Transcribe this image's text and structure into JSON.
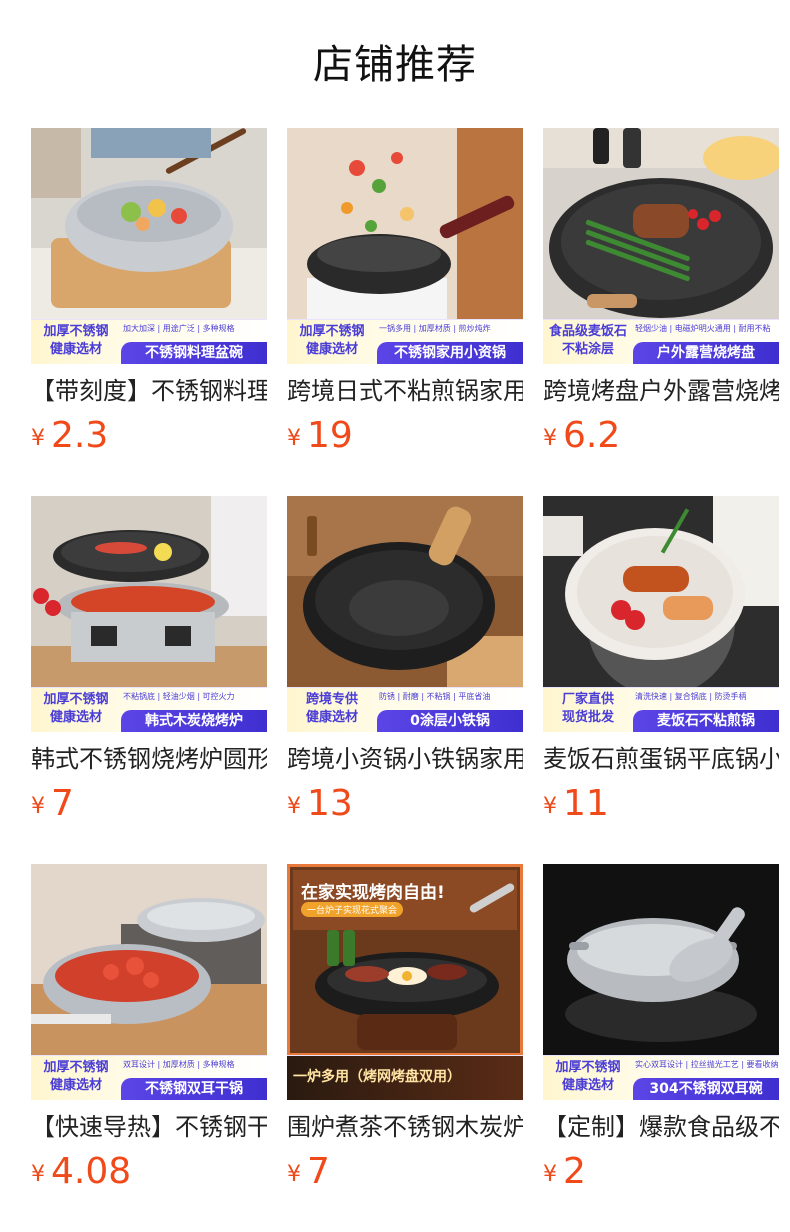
{
  "page": {
    "title": "店铺推荐"
  },
  "colors": {
    "price": "#f04a1a",
    "banner_purple": "#4a3dd6"
  },
  "products": [
    {
      "title": "【带刻度】不锈钢料理盆",
      "currency": "¥",
      "price": "2.3",
      "badge_line1": "加厚不锈钢",
      "badge_line2": "健康选材",
      "tags": "加大加深 | 用途广泛 | 多种规格",
      "pill": "不锈钢料理盆碗",
      "image": "stainless-bowl-salad"
    },
    {
      "title": "跨境日式不粘煎锅家用",
      "currency": "¥",
      "price": "19",
      "badge_line1": "加厚不锈钢",
      "badge_line2": "健康选材",
      "tags": "一锅多用 | 加厚材质 | 煎炒炖炸",
      "pill": "不锈钢家用小资锅",
      "image": "nonstick-wok-food-toss"
    },
    {
      "title": "跨境烤盘户外露营烧烤",
      "currency": "¥",
      "price": "6.2",
      "badge_line1": "食品级麦饭石",
      "badge_line2": "不粘涂层",
      "tags": "轻烟少油 | 电磁炉明火通用 | 耐用不粘",
      "pill": "户外露营烧烤盘",
      "image": "grill-pan-steak-asparagus"
    },
    {
      "title": "韩式不锈钢烧烤炉圆形",
      "currency": "¥",
      "price": "7",
      "badge_line1": "加厚不锈钢",
      "badge_line2": "健康选材",
      "tags": "不粘锅底 | 轻油少烟 | 可控火力",
      "pill": "韩式木炭烧烤炉",
      "image": "charcoal-bbq-stove"
    },
    {
      "title": "跨境小资锅小铁锅家用",
      "currency": "¥",
      "price": "13",
      "badge_line1": "跨境专供",
      "badge_line2": "健康选材",
      "tags": "防锈 | 耐磨 | 不粘锅 | 平底省油",
      "pill": "0涂层小铁锅",
      "image": "iron-wok-wood-handle"
    },
    {
      "title": "麦饭石煎蛋锅平底锅小",
      "currency": "¥",
      "price": "11",
      "badge_line1": "厂家直供",
      "badge_line2": "现货批发",
      "tags": "清洗快速 | 复合锅底 | 防烫手柄",
      "pill": "麦饭石不粘煎锅",
      "image": "white-frying-pan-sausage"
    },
    {
      "title": "【快速导热】不锈钢干锅",
      "currency": "¥",
      "price": "4.08",
      "badge_line1": "加厚不锈钢",
      "badge_line2": "健康选材",
      "tags": "双耳设计 | 加厚材质 | 多种规格",
      "pill": "不锈钢双耳干锅",
      "image": "double-ear-pot-crayfish"
    },
    {
      "title": "围炉煮茶不锈钢木炭炉",
      "currency": "¥",
      "price": "7",
      "banner_text": "一炉多用（烤网烤盘双用）",
      "headline": "在家实现烤肉自由!",
      "subline": "一台炉子实现花式聚会",
      "image": "korean-bbq-grill-meat"
    },
    {
      "title": "【定制】爆款食品级不锈",
      "currency": "¥",
      "price": "2",
      "badge_line1": "加厚不锈钢",
      "badge_line2": "健康选材",
      "tags": "实心双耳设计 | 拉丝抛光工艺 | 要看收纳",
      "pill": "304不锈钢双耳碗",
      "image": "steel-bowl-scoop-dark"
    }
  ]
}
